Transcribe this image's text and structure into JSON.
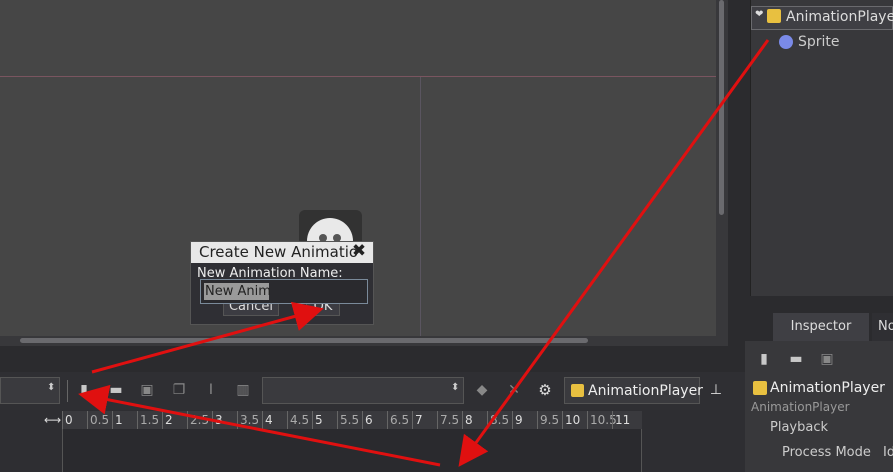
{
  "dialog": {
    "title": "Create New Animatio",
    "close_glyph": "✖",
    "label": "New Animation Name:",
    "input_value": "New Anim",
    "cancel": "Cancel",
    "ok": "OK"
  },
  "scene_tree": {
    "root": "AnimationPlayer",
    "child": "Sprite"
  },
  "inspector": {
    "tab_inspector": "Inspector",
    "tab_node": "No",
    "object": "AnimationPlayer",
    "object_sub": "AnimationPlayer",
    "section": "Playback",
    "property": "Process Mode",
    "property_value": "Id"
  },
  "toolbar": {
    "node_button": "AnimationPlayer",
    "icons": [
      "new-animation-icon",
      "load-icon",
      "save-icon",
      "duplicate-icon",
      "rename-icon",
      "delete-icon",
      "autoplay-icon",
      "blend-icon",
      "settings-icon",
      "pin-icon"
    ]
  },
  "timeline": {
    "ticks": [
      "0",
      "0.5",
      "1",
      "1.5",
      "2",
      "2.5",
      "3",
      "3.5",
      "4",
      "4.5",
      "5",
      "5.5",
      "6",
      "6.5",
      "7",
      "7.5",
      "8",
      "8.5",
      "9",
      "9.5",
      "10",
      "10.5",
      "11"
    ]
  },
  "colors": {
    "annotation_arrow": "#e01010",
    "anim_icon": "#e8c040"
  }
}
